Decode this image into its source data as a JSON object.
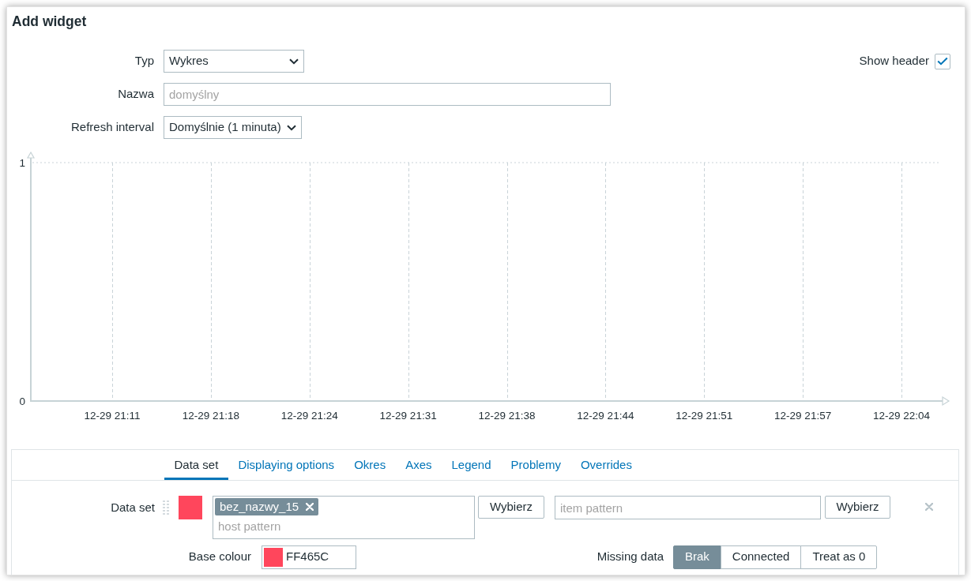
{
  "dialog": {
    "title": "Add widget"
  },
  "form": {
    "type": {
      "label": "Typ",
      "value": "Wykres"
    },
    "name": {
      "label": "Nazwa",
      "placeholder": "domyślny"
    },
    "refresh_interval": {
      "label": "Refresh interval",
      "value": "Domyślnie (1 minuta)"
    },
    "show_header": {
      "label": "Show header",
      "checked": true
    }
  },
  "preview": {
    "chart_data": {
      "type": "line",
      "categories": [
        "12-29 21:11",
        "12-29 21:18",
        "12-29 21:24",
        "12-29 21:31",
        "12-29 21:38",
        "12-29 21:44",
        "12-29 21:51",
        "12-29 21:57",
        "12-29 22:04"
      ],
      "ylim": [
        0,
        1
      ],
      "yticks": [
        0,
        1
      ],
      "grid": true
    }
  },
  "tabs": [
    {
      "label": "Data set",
      "selected": true
    },
    {
      "label": "Displaying options",
      "selected": false
    },
    {
      "label": "Okres",
      "selected": false
    },
    {
      "label": "Axes",
      "selected": false
    },
    {
      "label": "Legend",
      "selected": false
    },
    {
      "label": "Problemy",
      "selected": false
    },
    {
      "label": "Overrides",
      "selected": false
    }
  ],
  "data_sets": [
    {
      "label": "Data set",
      "color": "#ff465c",
      "hosts": [
        "bez_nazwy_15"
      ],
      "host_placeholder": "host pattern",
      "host_button": "Wybierz",
      "item_placeholder": "item pattern",
      "item_button": "Wybierz",
      "base_colour": {
        "label": "Base colour",
        "value": "FF465C"
      },
      "missing_data": {
        "label": "Missing data",
        "options": [
          {
            "label": "Brak",
            "selected": true
          },
          {
            "label": "Connected",
            "selected": false
          },
          {
            "label": "Treat as 0",
            "selected": false
          }
        ]
      }
    }
  ]
}
